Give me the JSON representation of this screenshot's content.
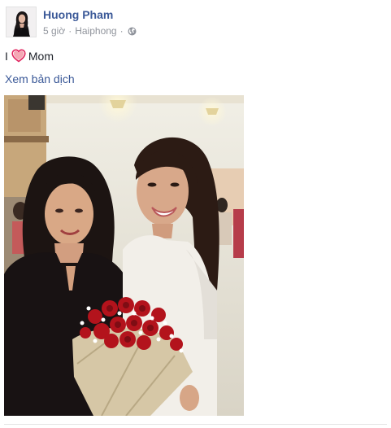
{
  "post": {
    "author_name": "Huong Pham",
    "time": "5 giờ",
    "location": "Haiphong",
    "privacy_icon": "globe-icon",
    "status": {
      "before_emoji": "I",
      "emoji": "heart-icon",
      "after_emoji": "Mom"
    },
    "translate_label": "Xem bản dịch",
    "photo_icon": "photo"
  },
  "colors": {
    "link": "#3b5998",
    "meta": "#90949c",
    "text": "#1d2129",
    "heart": "#e0245e"
  }
}
